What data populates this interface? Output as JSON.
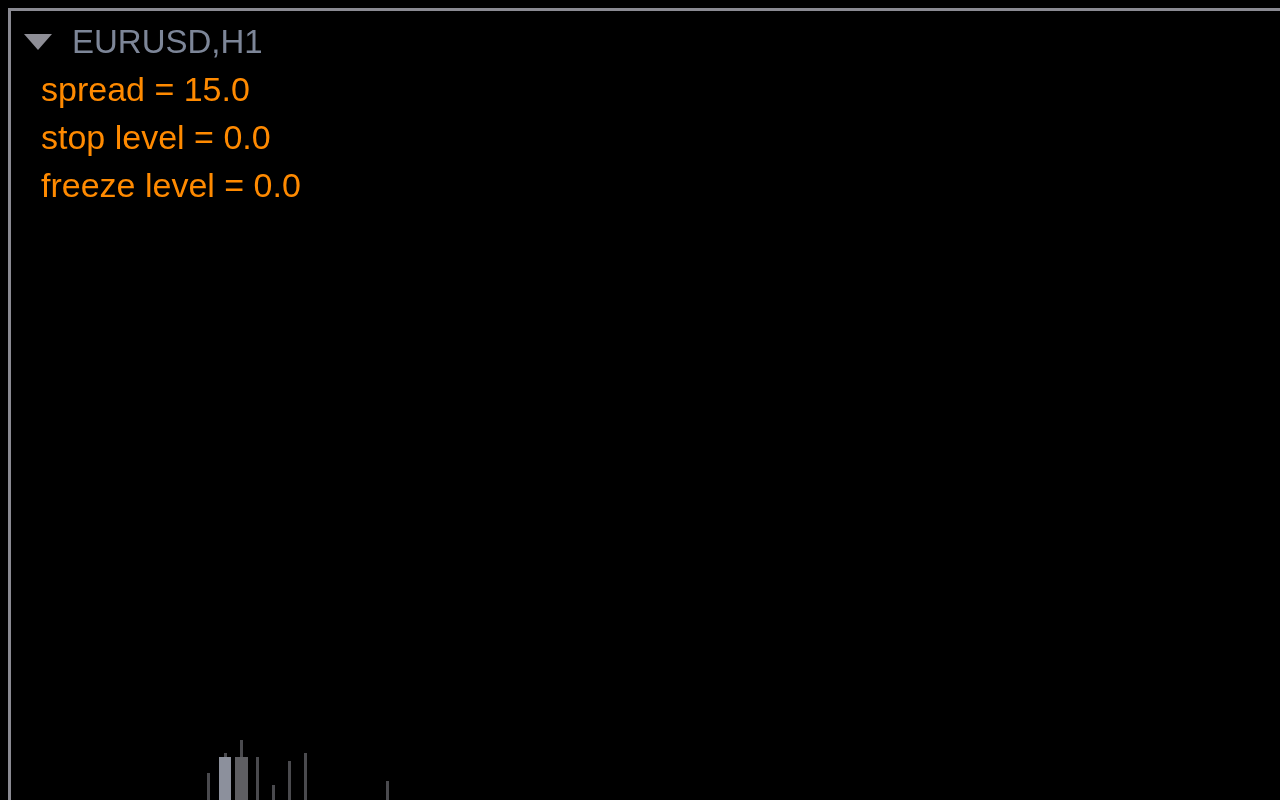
{
  "chart": {
    "title": "EURUSD,H1",
    "expanded": true,
    "info_lines": [
      "spread = 15.0",
      "stop level = 0.0",
      "freeze level = 0.0"
    ]
  }
}
